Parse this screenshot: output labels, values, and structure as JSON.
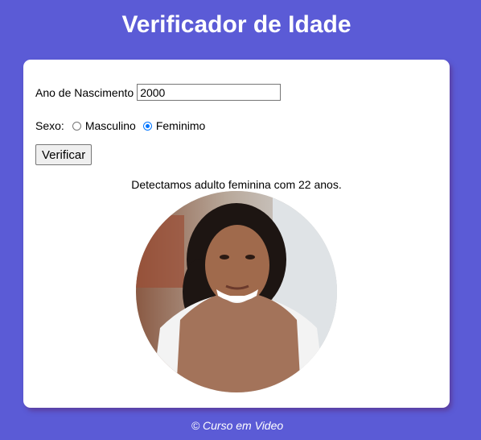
{
  "header": {
    "title": "Verificador de Idade"
  },
  "form": {
    "birth_year_label": "Ano de Nascimento",
    "birth_year_value": "2000",
    "sex_label": "Sexo:",
    "options": [
      {
        "label": "Masculino",
        "checked": false
      },
      {
        "label": "Feminimo",
        "checked": true
      }
    ],
    "submit_label": "Verificar"
  },
  "result": {
    "message": "Detectamos adulto feminina com 22 anos.",
    "photo_icon": "woman-adult-photo"
  },
  "footer": {
    "text": "© Curso em Video"
  },
  "colors": {
    "background": "#5b5bd6",
    "card": "#ffffff",
    "radio_accent": "#0075ff"
  }
}
